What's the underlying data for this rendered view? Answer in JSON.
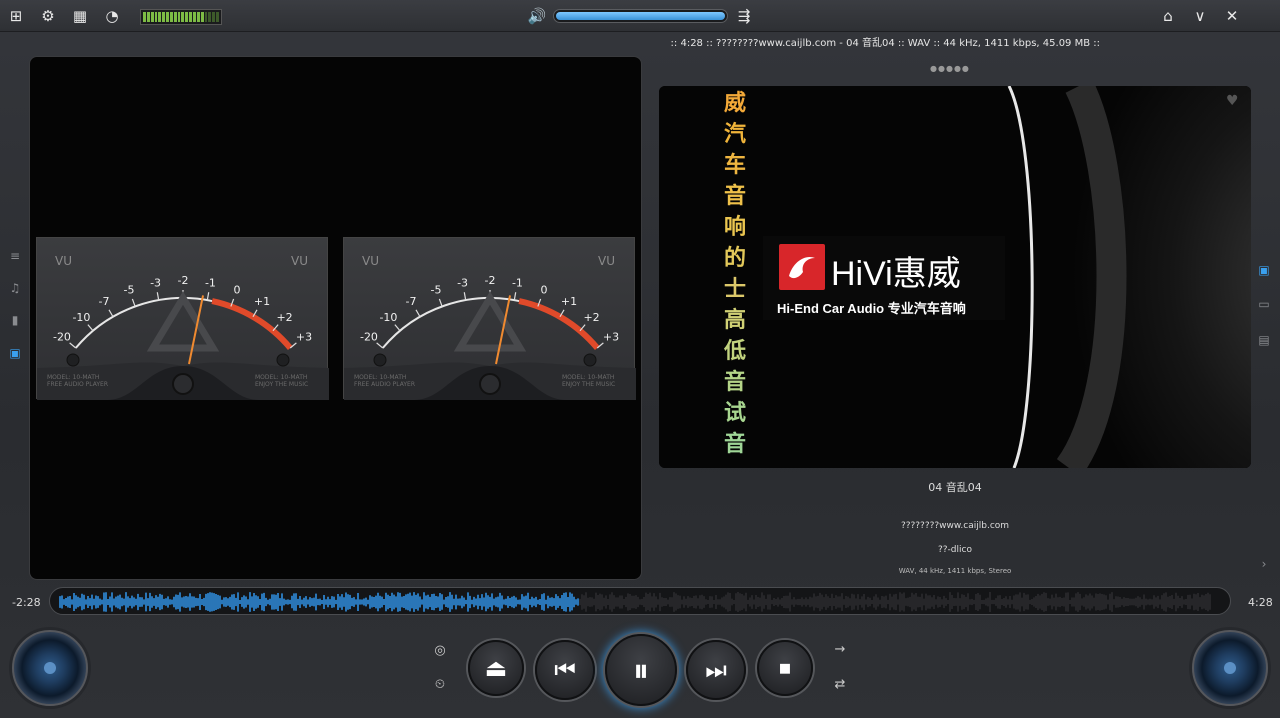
{
  "topbar": {
    "icons": [
      "grid-icon",
      "gear-icon",
      "layout-icon",
      "palette-icon"
    ],
    "volume_level": 1.0,
    "right_icons": [
      "mini-mode-icon",
      "minimize-icon",
      "close-icon"
    ],
    "glyphs": {
      "grid": "⊞",
      "gear": "⚙",
      "layout": "▦",
      "palette": "◔",
      "volume": "🔊",
      "equalizer": "⇶",
      "mini": "⌂",
      "minimize": "∨",
      "close": "✕"
    }
  },
  "info_line": ":: 4:28 :: ????????www.caijlb.com - 04 音乱04 :: WAV :: 44 kHz, 1411 kbps, 45.09 MB ::",
  "vu_meter": {
    "label": "VU",
    "scale": [
      "-20",
      "-10",
      "-7",
      "-5",
      "-3",
      "-2",
      "-1",
      "0",
      "+1",
      "+2",
      "+3"
    ],
    "footer_left": "MODEL: 10-MATH\nFREE AUDIO PLAYER",
    "footer_right": "MODEL: 10-MATH\nENJOY THE MUSIC",
    "needle_left": 0.58,
    "needle_right": 0.58
  },
  "art": {
    "vertical_text": [
      "威",
      "汽",
      "车",
      "音",
      "响",
      "的",
      "士",
      "高",
      "低",
      "音",
      "试",
      "音"
    ],
    "vertical_colors": [
      "#f3a938",
      "#f0b43a",
      "#eeb540",
      "#efc14a",
      "#ebc650",
      "#e2c85a",
      "#dcc86a",
      "#d1d175",
      "#c2d37e",
      "#b5d588",
      "#a8d690",
      "#9fd697"
    ],
    "brand_title": "HiVi惠威",
    "brand_sub": "Hi-End Car Audio 专业汽车音响"
  },
  "track": {
    "title": "04 音乱04",
    "artist": "????????www.caijlb.com",
    "album": "??-dlico",
    "format": "WAV, 44 kHz, 1411 kbps, Stereo"
  },
  "playback": {
    "elapsed": "-2:28",
    "total": "4:28",
    "progress": 0.45
  },
  "controls": {
    "eject": "⏏",
    "prev": "⏮",
    "pause": "⏸",
    "next": "⏭",
    "stop": "⏹",
    "repeat": "⇄",
    "next_mode": "→",
    "surround": "◎",
    "timer": "⏲"
  },
  "side_icons": {
    "left": [
      "≡",
      "♫",
      "▮",
      "▣"
    ],
    "right": [
      "▣",
      "▭",
      "▤"
    ]
  },
  "colors": {
    "accent": "#3a92d8",
    "wave_played": "#2f8fe0",
    "vu_red": "#e04a2a"
  }
}
